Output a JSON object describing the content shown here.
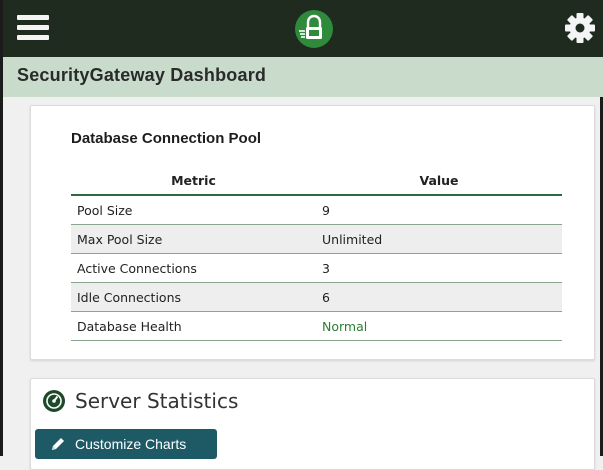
{
  "header": {
    "menu_icon": "hamburger-menu-icon",
    "logo_icon": "lock-shield-logo-icon",
    "settings_icon": "gear-icon",
    "bar_color": "#1f2b1f",
    "logo_color": "#2f8a3c"
  },
  "page": {
    "title": "SecurityGateway Dashboard",
    "title_bar_color": "#c9dccb"
  },
  "pool": {
    "title": "Database Connection Pool",
    "columns": [
      "Metric",
      "Value"
    ],
    "rows": [
      {
        "metric": "Pool Size",
        "value": "9"
      },
      {
        "metric": "Max Pool Size",
        "value": "Unlimited"
      },
      {
        "metric": "Active Connections",
        "value": "3"
      },
      {
        "metric": "Idle Connections",
        "value": "6"
      },
      {
        "metric": "Database Health",
        "value": "Normal"
      }
    ],
    "health_color": "#2e7d32"
  },
  "stats": {
    "icon": "dashboard-gauge-icon",
    "title": "Server Statistics",
    "customize_label": "Customize Charts",
    "customize_icon": "pencil-icon",
    "button_color": "#1e5a66"
  }
}
